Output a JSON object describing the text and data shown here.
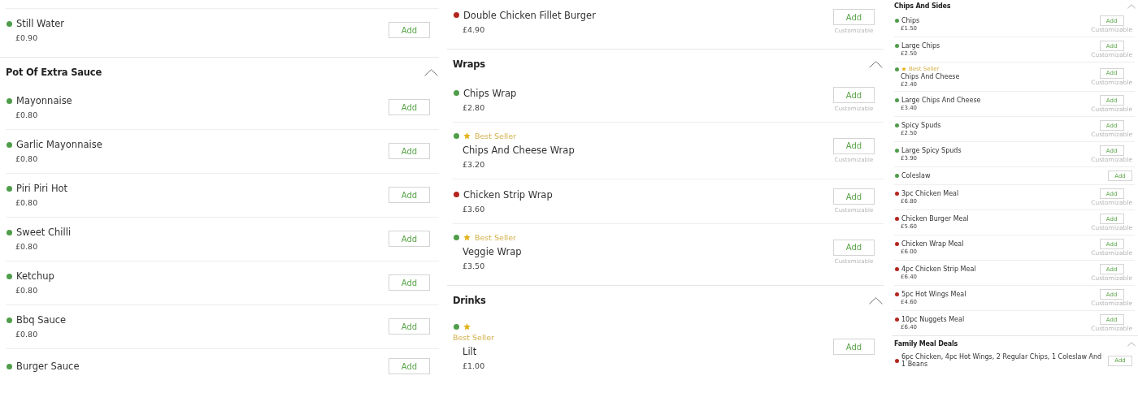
{
  "columns": [
    {
      "entries": [
        {
          "kind": "item",
          "name": "Still Water",
          "price": "£0.90",
          "color": "#4f9d4a",
          "button": "Add"
        },
        {
          "kind": "section",
          "title": "Pot Of Extra Sauce",
          "expanded": true
        },
        {
          "kind": "item",
          "name": "Mayonnaise",
          "price": "£0.80",
          "color": "#4f9d4a",
          "button": "Add"
        },
        {
          "kind": "item",
          "name": "Garlic Mayonnaise",
          "price": "£0.80",
          "color": "#4f9d4a",
          "button": "Add"
        },
        {
          "kind": "item",
          "name": "Piri Piri Hot",
          "price": "£0.80",
          "color": "#4f9d4a",
          "button": "Add"
        },
        {
          "kind": "item",
          "name": "Sweet Chilli",
          "price": "£0.80",
          "color": "#4f9d4a",
          "button": "Add"
        },
        {
          "kind": "item",
          "name": "Ketchup",
          "price": "£0.80",
          "color": "#4f9d4a",
          "button": "Add"
        },
        {
          "kind": "item",
          "name": "Bbq Sauce",
          "price": "£0.80",
          "color": "#4f9d4a",
          "button": "Add"
        },
        {
          "kind": "item",
          "name": "Burger Sauce",
          "color": "#4f9d4a",
          "button": "Add"
        }
      ]
    },
    {
      "entries": [
        {
          "kind": "item",
          "name": "Double Chicken Fillet Burger",
          "price": "£4.90",
          "color": "#b3261e",
          "button": "Add",
          "note": "Customizable"
        },
        {
          "kind": "section",
          "title": "Wraps",
          "expanded": true
        },
        {
          "kind": "item",
          "name": "Chips Wrap",
          "price": "£2.80",
          "color": "#4f9d4a",
          "button": "Add",
          "note": "Customizable"
        },
        {
          "kind": "item",
          "badge": "Best Seller",
          "name": "Chips And Cheese Wrap",
          "price": "£3.20",
          "color": "#4f9d4a",
          "button": "Add",
          "note": "Customizable"
        },
        {
          "kind": "item",
          "name": "Chicken Strip Wrap",
          "price": "£3.60",
          "color": "#b3261e",
          "button": "Add",
          "note": "Customizable"
        },
        {
          "kind": "item",
          "badge": "Best Seller",
          "name": "Veggie Wrap",
          "price": "£3.50",
          "color": "#4f9d4a",
          "button": "Add",
          "note": "Customizable"
        },
        {
          "kind": "section",
          "title": "Drinks",
          "expanded": true
        },
        {
          "kind": "stacked",
          "badge": "Best Seller",
          "name": "Lilt",
          "price": "£1.00",
          "color": "#4f9d4a",
          "button": "Add"
        }
      ]
    },
    {
      "entries": [
        {
          "kind": "section",
          "title": "Chips And Sides",
          "expanded": true
        },
        {
          "kind": "item",
          "name": "Chips",
          "price": "£1.50",
          "color": "#4f9d4a",
          "button": "Add",
          "note": "Customizable"
        },
        {
          "kind": "item",
          "name": "Large Chips",
          "price": "£2.50",
          "color": "#4f9d4a",
          "button": "Add",
          "note": "Customizable"
        },
        {
          "kind": "item",
          "badge": "Best Seller",
          "name": "Chips And Cheese",
          "price": "£2.40",
          "color": "#4f9d4a",
          "button": "Add",
          "note": "Customizable"
        },
        {
          "kind": "item",
          "name": "Large Chips And Cheese",
          "price": "£3.40",
          "color": "#4f9d4a",
          "button": "Add",
          "note": "Customizable"
        },
        {
          "kind": "item",
          "name": "Spicy Spuds",
          "price": "£2.50",
          "color": "#4f9d4a",
          "button": "Add",
          "note": "Customizable"
        },
        {
          "kind": "item",
          "name": "Large Spicy Spuds",
          "price": "£3.90",
          "color": "#4f9d4a",
          "button": "Add",
          "note": "Customizable"
        },
        {
          "kind": "item",
          "name": "Coleslaw",
          "color": "#4f9d4a",
          "button": "Add"
        },
        {
          "kind": "item",
          "name": "3pc Chicken Meal",
          "price": "£6.80",
          "color": "#b3261e",
          "button": "Add",
          "note": "Customizable"
        },
        {
          "kind": "item",
          "name": "Chicken Burger Meal",
          "price": "£5.60",
          "color": "#b3261e",
          "button": "Add",
          "note": "Customizable"
        },
        {
          "kind": "item",
          "name": "Chicken Wrap Meal",
          "price": "£6.00",
          "color": "#b3261e",
          "button": "Add",
          "note": "Customizable"
        },
        {
          "kind": "item",
          "name": "4pc Chicken Strip Meal",
          "price": "£6.40",
          "color": "#b3261e",
          "button": "Add",
          "note": "Customizable"
        },
        {
          "kind": "item",
          "name": "5pc Hot Wings Meal",
          "price": "£4.60",
          "color": "#b3261e",
          "button": "Add",
          "note": "Customizable"
        },
        {
          "kind": "item",
          "name": "10pc Nuggets Meal",
          "price": "£6.40",
          "color": "#b3261e",
          "button": "Add",
          "note": "Customizable"
        },
        {
          "kind": "section",
          "title": "Family Meal Deals",
          "expanded": true
        },
        {
          "kind": "item",
          "name": "6pc Chicken, 4pc Hot Wings, 2 Regular Chips, 1 Coleslaw And 1 Beans",
          "color": "#b3261e",
          "button": "Add"
        }
      ]
    }
  ]
}
